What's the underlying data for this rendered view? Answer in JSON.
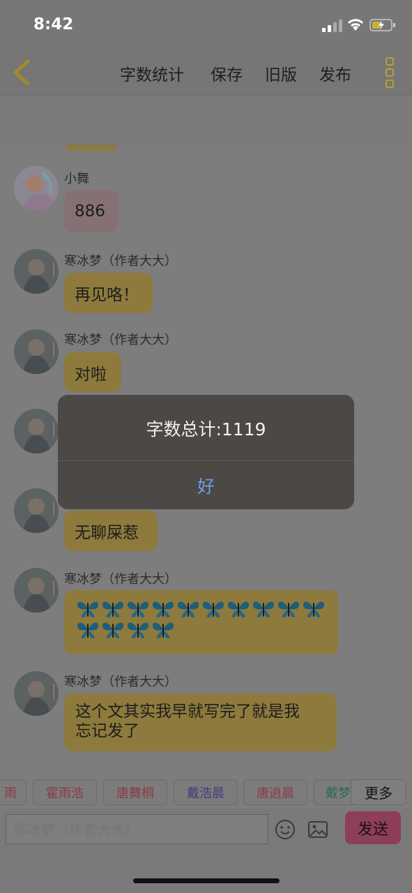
{
  "status": {
    "time": "8:42"
  },
  "nav": {
    "items": [
      "字数统计",
      "保存",
      "旧版",
      "发布"
    ]
  },
  "messages": [
    {
      "sender": "小舞",
      "text": "886"
    },
    {
      "sender": "寒冰梦（作者大大）",
      "text": "再见咯！"
    },
    {
      "sender": "寒冰梦（作者大大）",
      "text": "对啦"
    },
    {
      "sender": "",
      "text": ""
    },
    {
      "sender": "",
      "text": "无聊屎惹"
    },
    {
      "sender": "寒冰梦（作者大大）",
      "text": "🦋🦋🦋🦋🦋🦋🦋🦋🦋🦋🦋🦋🦋🦋",
      "butterfly_count": 14
    },
    {
      "sender": "寒冰梦（作者大大）",
      "text_line1": "这个文其实我早就写完了就是我",
      "text_line2": "忘记发了"
    }
  ],
  "chips": [
    "雨",
    "霍雨浩",
    "唐舞桐",
    "戴浩晨",
    "唐逍晨",
    "戴梦"
  ],
  "chip_colors": [
    "#8a3a45",
    "#8a3a45",
    "#8a3a45",
    "#4a3a7a",
    "#8a3a45",
    "#2a6a5a"
  ],
  "more_label": "更多",
  "input": {
    "placeholder": "寒冰梦（作者大大）:"
  },
  "send_label": "发送",
  "alert": {
    "message": "字数总计:1119",
    "button": "好"
  },
  "colors": {
    "accent": "#b9a033",
    "bubble_yellow": "#8d7a3c",
    "send": "#8d3f58",
    "alert_button": "#6d9fe8"
  }
}
